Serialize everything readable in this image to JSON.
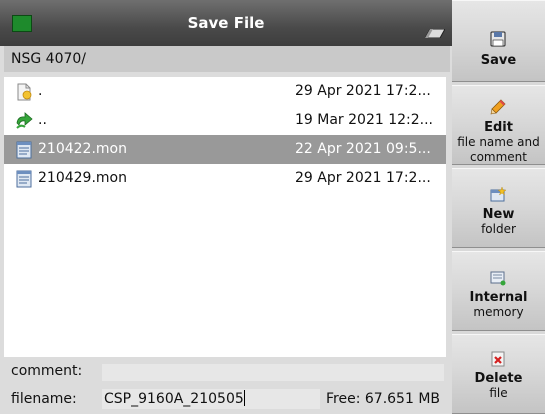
{
  "window": {
    "title": "Save File"
  },
  "path": "NSG 4070/",
  "files": [
    {
      "name": ".",
      "date": "29 Apr 2021 17:2...",
      "icon": "folder-current-icon",
      "selected": false
    },
    {
      "name": "..",
      "date": "19 Mar 2021 12:2...",
      "icon": "folder-up-icon",
      "selected": false
    },
    {
      "name": "210422.mon",
      "date": "22 Apr 2021 09:5...",
      "icon": "document-icon",
      "selected": true
    },
    {
      "name": "210429.mon",
      "date": "29 Apr 2021 17:2...",
      "icon": "document-icon",
      "selected": false
    }
  ],
  "comment": {
    "label": "comment:",
    "value": ""
  },
  "filename": {
    "label": "filename:",
    "value": "CSP_9160A_210505"
  },
  "free_space": "Free: 67.651 MB",
  "softkeys": {
    "save": {
      "title": "Save"
    },
    "edit": {
      "title": "Edit",
      "subtitle": "file name and comment"
    },
    "new": {
      "title": "New",
      "subtitle": "folder"
    },
    "internal": {
      "title": "Internal",
      "subtitle": "memory"
    },
    "delete": {
      "title": "Delete",
      "subtitle": "file"
    }
  },
  "colors": {
    "title_bar": "#4a4a4a",
    "selection": "#999999",
    "status_led": "#1e8a2c",
    "delete_red": "#d42020"
  }
}
